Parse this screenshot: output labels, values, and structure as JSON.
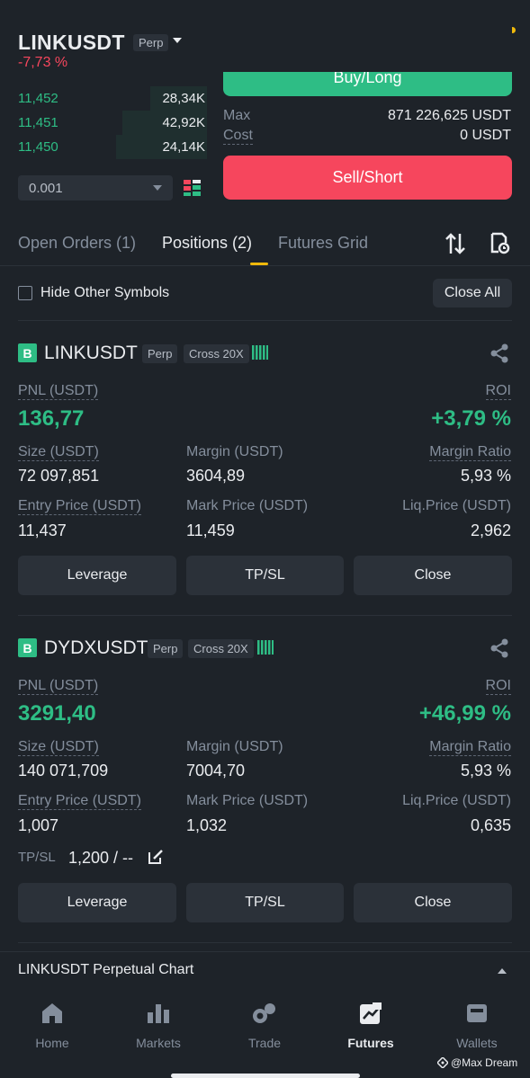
{
  "header": {
    "symbol": "LINKUSDT",
    "type_chip": "Perp",
    "change": "-7,73 %",
    "icons": [
      "candle-settings-icon",
      "chart-icon",
      "percent-icon",
      "more-icon"
    ]
  },
  "orderbook": {
    "rows": [
      {
        "price": "11,452",
        "qty": "28,34K",
        "depth": 0.3
      },
      {
        "price": "11,451",
        "qty": "42,92K",
        "depth": 0.45
      },
      {
        "price": "11,450",
        "qty": "24,14K",
        "depth": 0.48
      }
    ],
    "precision_value": "0.001"
  },
  "trade_panel": {
    "buy_label": "Buy/Long",
    "max_label": "Max",
    "max_value": "871 226,625 USDT",
    "cost_label": "Cost",
    "cost_value": "0 USDT",
    "sell_label": "Sell/Short"
  },
  "tabs": {
    "items": [
      "Open Orders (1)",
      "Positions (2)",
      "Futures Grid"
    ],
    "active": "Positions (2)"
  },
  "filter": {
    "hide_label": "Hide Other Symbols",
    "close_all": "Close All"
  },
  "positions": [
    {
      "side_badge": "B",
      "symbol": "LINKUSDT",
      "type_chip": "Perp",
      "margin_chip": "Cross 20X",
      "pnl_label": "PNL (USDT)",
      "pnl_value": "136,77",
      "roi_label": "ROI",
      "roi_value": "+3,79 %",
      "size_label": "Size (USDT)",
      "size_value": "72 097,851",
      "margin_label": "Margin (USDT)",
      "margin_value": "3604,89",
      "ratio_label": "Margin Ratio",
      "ratio_value": "5,93 %",
      "entry_label": "Entry Price (USDT)",
      "entry_value": "11,437",
      "mark_label": "Mark Price (USDT)",
      "mark_value": "11,459",
      "liq_label": "Liq.Price (USDT)",
      "liq_value": "2,962",
      "buttons": [
        "Leverage",
        "TP/SL",
        "Close"
      ]
    },
    {
      "side_badge": "B",
      "symbol": "DYDXUSDT",
      "type_chip": "Perp",
      "margin_chip": "Cross 20X",
      "pnl_label": "PNL (USDT)",
      "pnl_value": "3291,40",
      "roi_label": "ROI",
      "roi_value": "+46,99 %",
      "size_label": "Size (USDT)",
      "size_value": "140 071,709",
      "margin_label": "Margin (USDT)",
      "margin_value": "7004,70",
      "ratio_label": "Margin Ratio",
      "ratio_value": "5,93 %",
      "entry_label": "Entry Price (USDT)",
      "entry_value": "1,007",
      "mark_label": "Mark Price (USDT)",
      "mark_value": "1,032",
      "liq_label": "Liq.Price (USDT)",
      "liq_value": "0,635",
      "tpsl_label": "TP/SL",
      "tpsl_value": "1,200 / --",
      "buttons": [
        "Leverage",
        "TP/SL",
        "Close"
      ]
    }
  ],
  "chart_bar": {
    "label": "LINKUSDT Perpetual  Chart"
  },
  "nav": {
    "items": [
      {
        "label": "Home",
        "icon": "home-icon"
      },
      {
        "label": "Markets",
        "icon": "markets-icon"
      },
      {
        "label": "Trade",
        "icon": "trade-icon"
      },
      {
        "label": "Futures",
        "icon": "futures-icon"
      },
      {
        "label": "Wallets",
        "icon": "wallet-icon"
      }
    ],
    "active": "Futures"
  },
  "watermark": "@Max Dream",
  "colors": {
    "bg": "#1e2329",
    "green": "#2ebd85",
    "red": "#f6465d",
    "accent": "#f0b90b"
  }
}
